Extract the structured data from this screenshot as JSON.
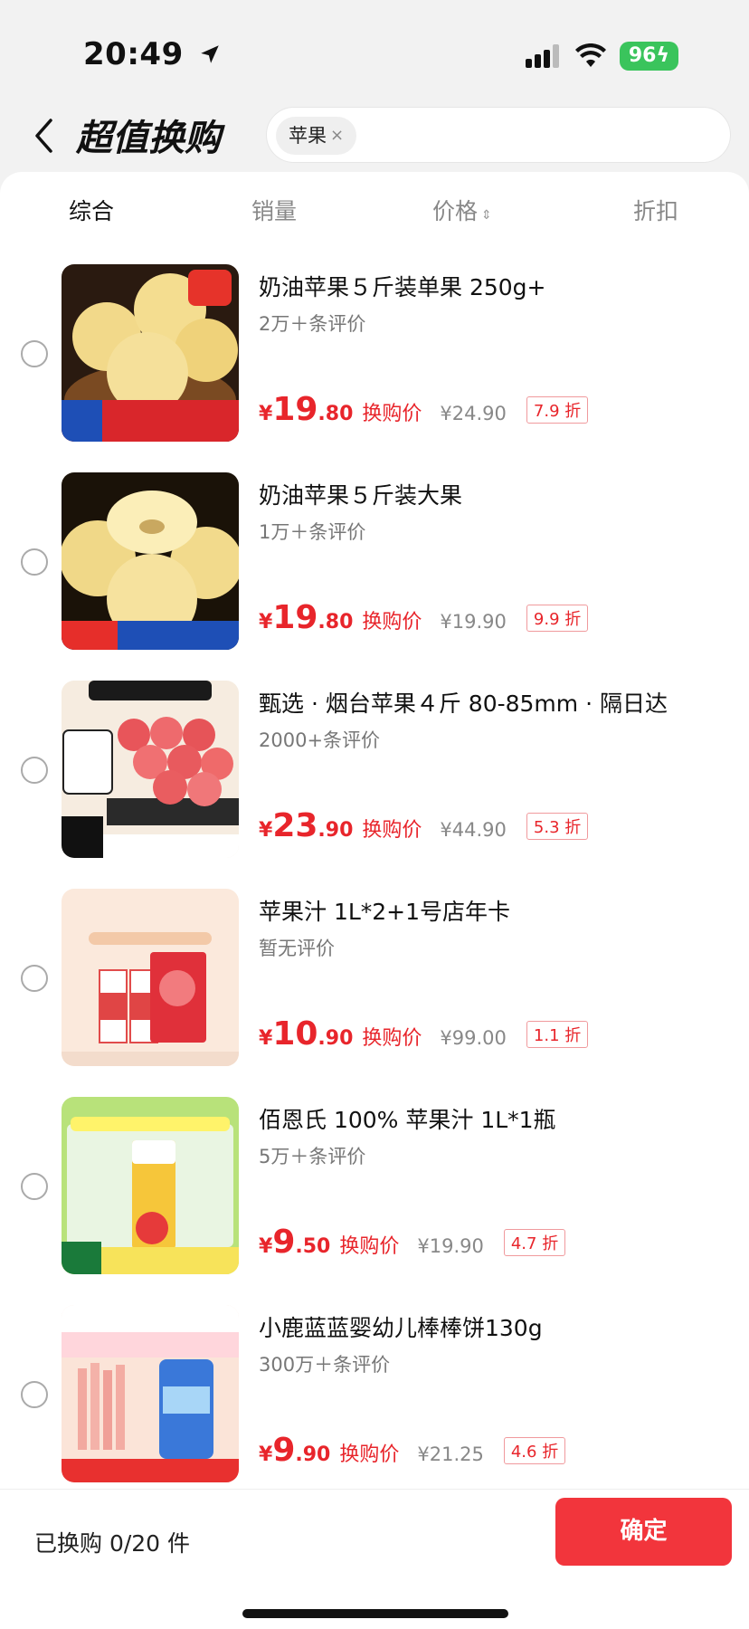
{
  "status_bar": {
    "time": "20:49",
    "battery": "96"
  },
  "header": {
    "title": "超值换购",
    "search_chip": "苹果",
    "chip_close": "×"
  },
  "sort_tabs": [
    "综合",
    "销量",
    "价格",
    "折扣"
  ],
  "sort_arrows": "⌃⌄",
  "items": [
    {
      "title": "奶油苹果５斤装单果 250g+",
      "reviews": "2万＋条评价",
      "currency": "¥",
      "price_int": "19",
      "price_dec": ".80",
      "price_label": "换购价",
      "original_price": "¥24.90",
      "discount": "7.9 折"
    },
    {
      "title": "奶油苹果５斤装大果",
      "reviews": "1万＋条评价",
      "currency": "¥",
      "price_int": "19",
      "price_dec": ".80",
      "price_label": "换购价",
      "original_price": "¥19.90",
      "discount": "9.9 折"
    },
    {
      "title": "甄选 · 烟台苹果４斤 80-85mm · 隔日达",
      "reviews": "2000+条评价",
      "currency": "¥",
      "price_int": "23",
      "price_dec": ".90",
      "price_label": "换购价",
      "original_price": "¥44.90",
      "discount": "5.3 折"
    },
    {
      "title": "苹果汁 1L*2+1号店年卡",
      "reviews": "暂无评价",
      "currency": "¥",
      "price_int": "10",
      "price_dec": ".90",
      "price_label": "换购价",
      "original_price": "¥99.00",
      "discount": "1.1 折"
    },
    {
      "title": "佰恩氏 100% 苹果汁 1L*1瓶",
      "reviews": "5万＋条评价",
      "currency": "¥",
      "price_int": "9",
      "price_dec": ".50",
      "price_label": "换购价",
      "original_price": "¥19.90",
      "discount": "4.7 折"
    },
    {
      "title": "小鹿蓝蓝婴幼儿棒棒饼130g",
      "reviews": "300万＋条评价",
      "currency": "¥",
      "price_int": "9",
      "price_dec": ".90",
      "price_label": "换购价",
      "original_price": "¥21.25",
      "discount": "4.6 折"
    }
  ],
  "footer": {
    "status": "已换购 0/20 件",
    "confirm": "确定"
  }
}
